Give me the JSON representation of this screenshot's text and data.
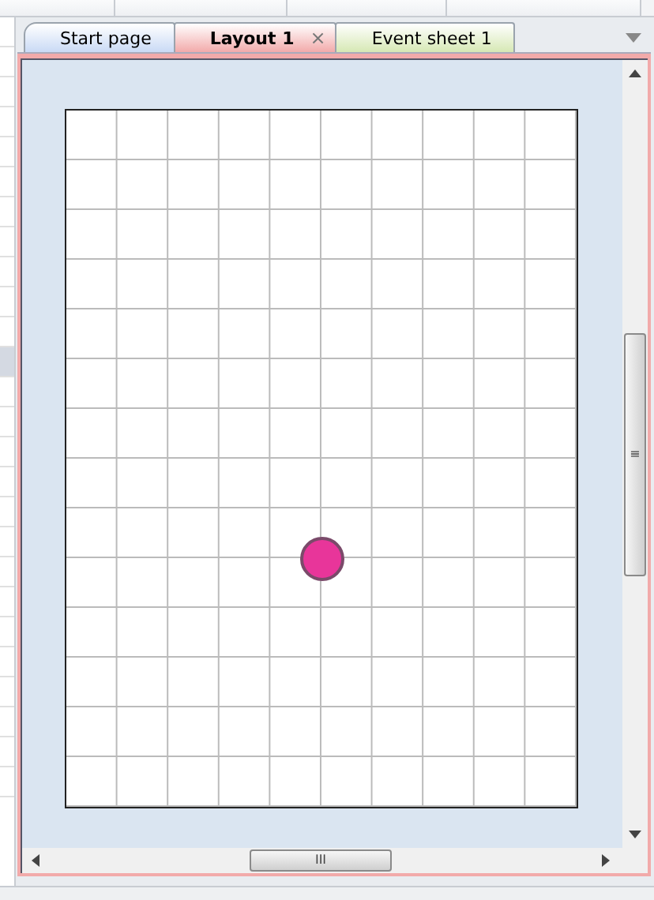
{
  "tabs": [
    {
      "label": "Start page",
      "selected": false,
      "color": "#c9daf5"
    },
    {
      "label": "Layout 1",
      "selected": true,
      "close_glyph": "×",
      "color": "#f2aaaa"
    },
    {
      "label": "Event sheet 1",
      "selected": false,
      "color": "#d6e8b4"
    }
  ],
  "layout": {
    "objects": [
      {
        "kind": "sprite",
        "color": "#e8359a"
      }
    ]
  },
  "side_list": {
    "rows": [
      {
        "selected": false
      },
      {
        "selected": false
      },
      {
        "selected": false
      },
      {
        "selected": false
      },
      {
        "selected": false
      },
      {
        "selected": false
      },
      {
        "selected": false
      },
      {
        "selected": false
      },
      {
        "selected": false
      },
      {
        "selected": false
      },
      {
        "selected": false
      },
      {
        "selected": true
      },
      {
        "selected": false
      },
      {
        "selected": false
      },
      {
        "selected": false
      },
      {
        "selected": false
      },
      {
        "selected": false
      },
      {
        "selected": false
      },
      {
        "selected": false
      },
      {
        "selected": false
      },
      {
        "selected": false
      },
      {
        "selected": false
      },
      {
        "selected": false
      },
      {
        "selected": false
      },
      {
        "selected": false
      },
      {
        "selected": false
      }
    ]
  },
  "vertical_scrollbar": {
    "grip": "≡"
  },
  "horizontal_scrollbar": {
    "grip": "III"
  }
}
